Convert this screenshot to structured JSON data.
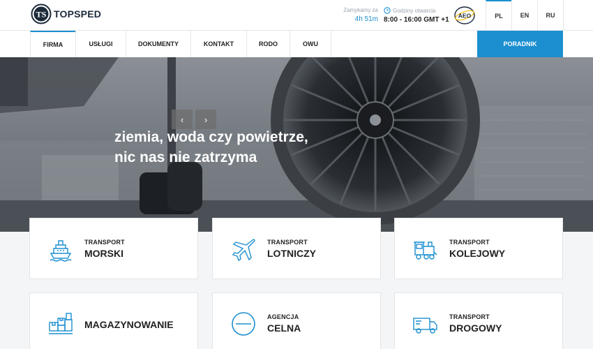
{
  "brand": {
    "name": "TOPSPED",
    "mark": "TS"
  },
  "header": {
    "closing_label": "Zamykamy za",
    "closing_value": "4h 51m",
    "hours_label": "Godziny otwarcia",
    "hours_value": "8:00 - 16:00 GMT +1",
    "badge_text": "AEO",
    "languages": [
      "PL",
      "EN",
      "RU"
    ],
    "active_language": "PL"
  },
  "nav": {
    "items": [
      "FIRMA",
      "USŁUGI",
      "DOKUMENTY",
      "KONTAKT",
      "RODO",
      "OWU"
    ],
    "active": "FIRMA",
    "guide": "PORADNIK"
  },
  "hero": {
    "line1": "ziemia, woda czy powietrze,",
    "line2": "nic nas nie zatrzyma",
    "prev_icon": "chevron-left-icon",
    "next_icon": "chevron-right-icon"
  },
  "services": [
    {
      "small": "TRANSPORT",
      "big": "MORSKI",
      "icon": "ship-icon"
    },
    {
      "small": "TRANSPORT",
      "big": "LOTNICZY",
      "icon": "plane-icon"
    },
    {
      "small": "TRANSPORT",
      "big": "KOLEJOWY",
      "icon": "train-icon"
    },
    {
      "small": "",
      "big": "MAGAZYNOWANIE",
      "icon": "warehouse-boxes-icon"
    },
    {
      "small": "AGENCJA",
      "big": "CELNA",
      "icon": "customs-icon"
    },
    {
      "small": "TRANSPORT",
      "big": "DROGOWY",
      "icon": "truck-icon"
    }
  ],
  "colors": {
    "accent": "#1b8fd0",
    "dark": "#1d2a3a",
    "text": "#222222"
  }
}
